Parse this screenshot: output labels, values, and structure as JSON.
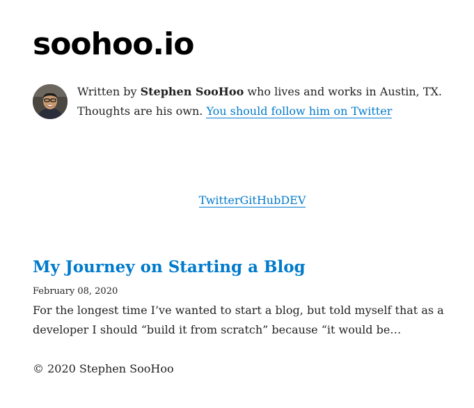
{
  "site": {
    "title": "soohoo.io"
  },
  "bio": {
    "prefix": "Written by ",
    "author": "Stephen SooHoo",
    "middle": " who lives and works in Austin, TX. Thoughts are his own. ",
    "follow_link": "You should follow him on Twitter"
  },
  "social": {
    "links": [
      "Twitter",
      "GitHub",
      "DEV"
    ]
  },
  "post": {
    "title": "My Journey on Starting a Blog",
    "date": "February 08, 2020",
    "excerpt": "For the longest time I’ve wanted to start a blog, but told myself that as a developer I should “build it from scratch” because “it would be…"
  },
  "footer": {
    "text": "© 2020 Stephen SooHoo"
  },
  "colors": {
    "link": "#007acc",
    "text": "#222222",
    "title": "#000000"
  }
}
